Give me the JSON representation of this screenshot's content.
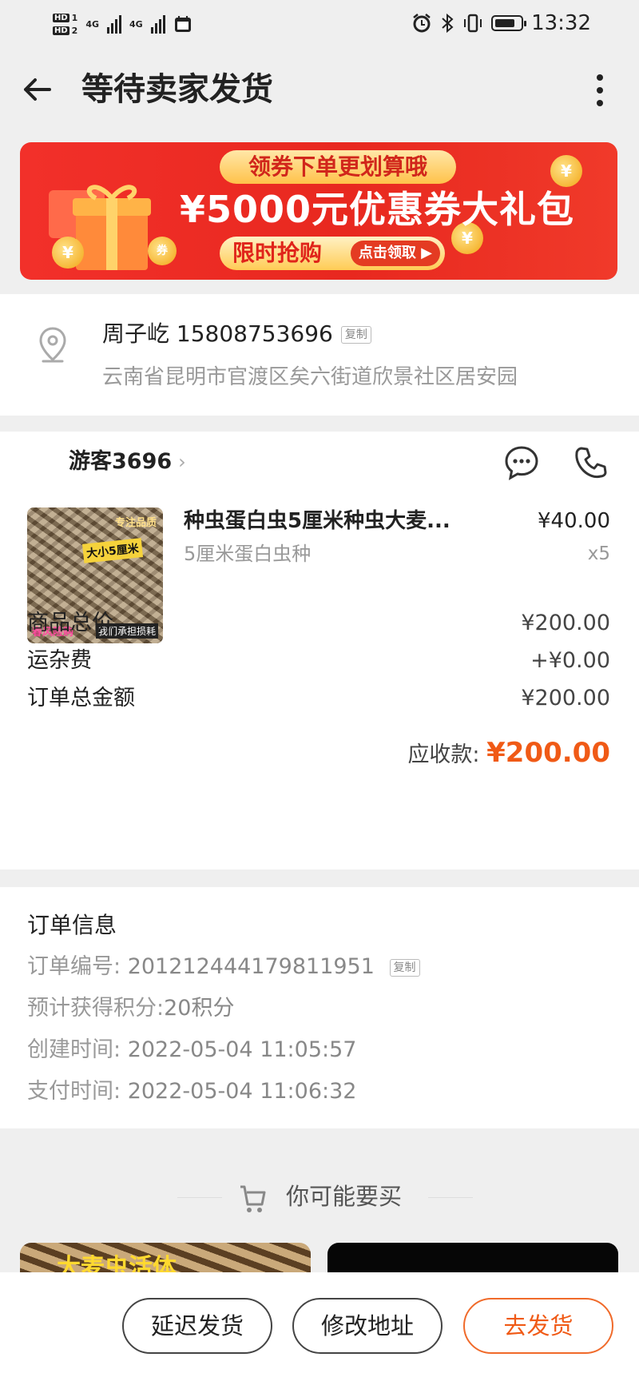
{
  "status_bar": {
    "sim1": "HD",
    "sim1_num": "1",
    "sim2": "HD",
    "sim2_num": "2",
    "net1": "4G",
    "net2": "4G",
    "time": "13:32"
  },
  "header": {
    "title": "等待卖家发货"
  },
  "banner": {
    "top_text": "领券下单更划算哦",
    "main_text": "¥5000元优惠券大礼包",
    "bottom_text": "限时抢购",
    "claim_label": "点击领取"
  },
  "address": {
    "name_phone": "周子屹 15808753696",
    "copy_label": "复制",
    "full_address": "云南省昆明市官渡区矣六街道欣景社区居安园"
  },
  "order": {
    "shop_name": "游客3696",
    "product": {
      "title": "种虫蛋白虫5厘米种虫大麦...",
      "spec": "5厘米蛋白虫种",
      "price": "¥40.00",
      "qty": "x5",
      "image_texts": [
        "大小5厘米",
        "专注品质",
        "春风险购",
        "我们承担损耗"
      ]
    },
    "summary": [
      {
        "label": "商品总价",
        "value": "¥200.00"
      },
      {
        "label": "运杂费",
        "value": "+¥0.00"
      },
      {
        "label": "订单总金额",
        "value": "¥200.00"
      }
    ],
    "due_label": "应收款:",
    "due_amount": "¥200.00"
  },
  "order_info": {
    "heading": "订单信息",
    "order_no_label": "订单编号:",
    "order_no": "201212444179811951",
    "copy_label": "复制",
    "points_label": "预计获得积分:",
    "points": "20积分",
    "created_label": "创建时间:",
    "created": "2022-05-04 11:05:57",
    "paid_label": "支付时间:",
    "paid": "2022-05-04 11:06:32"
  },
  "recommend": {
    "title": "你可能要买",
    "item1_text": "大麦虫活体"
  },
  "actions": {
    "delay_label": "延迟发货",
    "modify_address_label": "修改地址",
    "ship_label": "去发货"
  },
  "colors": {
    "accent": "#f05a16",
    "banner_red": "#e8281f"
  }
}
